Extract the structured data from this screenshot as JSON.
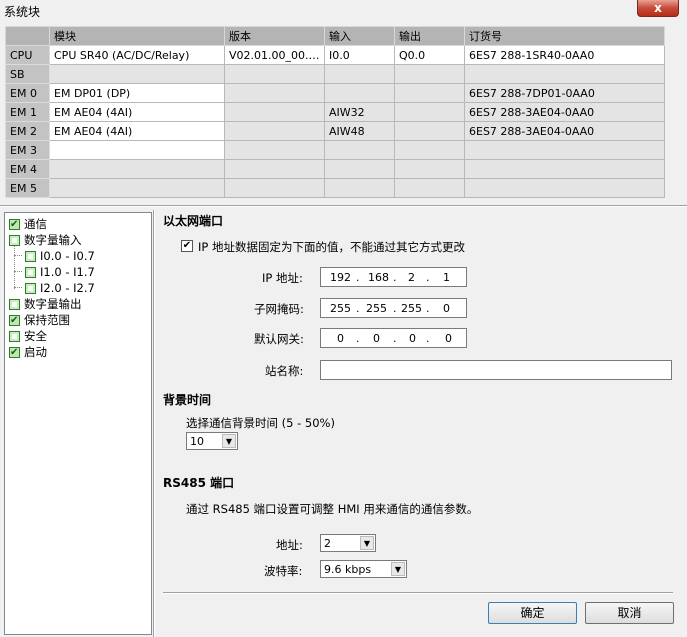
{
  "window": {
    "title": "系统块",
    "close_label": "x"
  },
  "table": {
    "headers": [
      "",
      "模块",
      "版本",
      "输入",
      "输出",
      "订货号"
    ],
    "rows": [
      {
        "slot": "CPU",
        "module": "CPU SR40 (AC/DC/Relay)",
        "version": "V02.01.00_00.00...",
        "input": "I0.0",
        "output": "Q0.0",
        "order": "6ES7 288-1SR40-0AA0"
      },
      {
        "slot": "SB",
        "module": "",
        "version": "",
        "input": "",
        "output": "",
        "order": ""
      },
      {
        "slot": "EM 0",
        "module": "EM DP01 (DP)",
        "version": "",
        "input": "",
        "output": "",
        "order": "6ES7 288-7DP01-0AA0"
      },
      {
        "slot": "EM 1",
        "module": "EM AE04 (4AI)",
        "version": "",
        "input": "AIW32",
        "output": "",
        "order": "6ES7 288-3AE04-0AA0"
      },
      {
        "slot": "EM 2",
        "module": "EM AE04 (4AI)",
        "version": "",
        "input": "AIW48",
        "output": "",
        "order": "6ES7 288-3AE04-0AA0"
      },
      {
        "slot": "EM 3",
        "module": "",
        "version": "",
        "input": "",
        "output": "",
        "order": ""
      },
      {
        "slot": "EM 4",
        "module": "",
        "version": "",
        "input": "",
        "output": "",
        "order": ""
      },
      {
        "slot": "EM 5",
        "module": "",
        "version": "",
        "input": "",
        "output": "",
        "order": ""
      }
    ]
  },
  "tree": {
    "items": [
      {
        "label": "通信",
        "checked": true
      },
      {
        "label": "数字量输入",
        "checked": false
      },
      {
        "label": "I0.0 - I0.7",
        "checked": false
      },
      {
        "label": "I1.0 - I1.7",
        "checked": false
      },
      {
        "label": "I2.0 - I2.7",
        "checked": false
      },
      {
        "label": "数字量输出",
        "checked": false
      },
      {
        "label": "保持范围",
        "checked": true
      },
      {
        "label": "安全",
        "checked": false
      },
      {
        "label": "启动",
        "checked": true
      }
    ]
  },
  "ethernet": {
    "title": "以太网端口",
    "fixed_ip_label": "IP 地址数据固定为下面的值，不能通过其它方式更改",
    "fixed_ip_checked": true,
    "ip_label": "IP 地址:",
    "ip": [
      "192",
      "168",
      "2",
      "1"
    ],
    "subnet_label": "子网掩码:",
    "subnet": [
      "255",
      "255",
      "255",
      "0"
    ],
    "gateway_label": "默认网关:",
    "gateway": [
      "0",
      "0",
      "0",
      "0"
    ],
    "station_label": "站名称:",
    "station_value": ""
  },
  "background": {
    "title": "背景时间",
    "select_label": "选择通信背景时间 (5 - 50%)",
    "value": "10"
  },
  "rs485": {
    "title": "RS485 端口",
    "desc": "通过 RS485 端口设置可调整 HMI 用来通信的通信参数。",
    "address_label": "地址:",
    "address_value": "2",
    "baud_label": "波特率:",
    "baud_value": "9.6 kbps"
  },
  "buttons": {
    "ok": "确定",
    "cancel": "取消"
  }
}
